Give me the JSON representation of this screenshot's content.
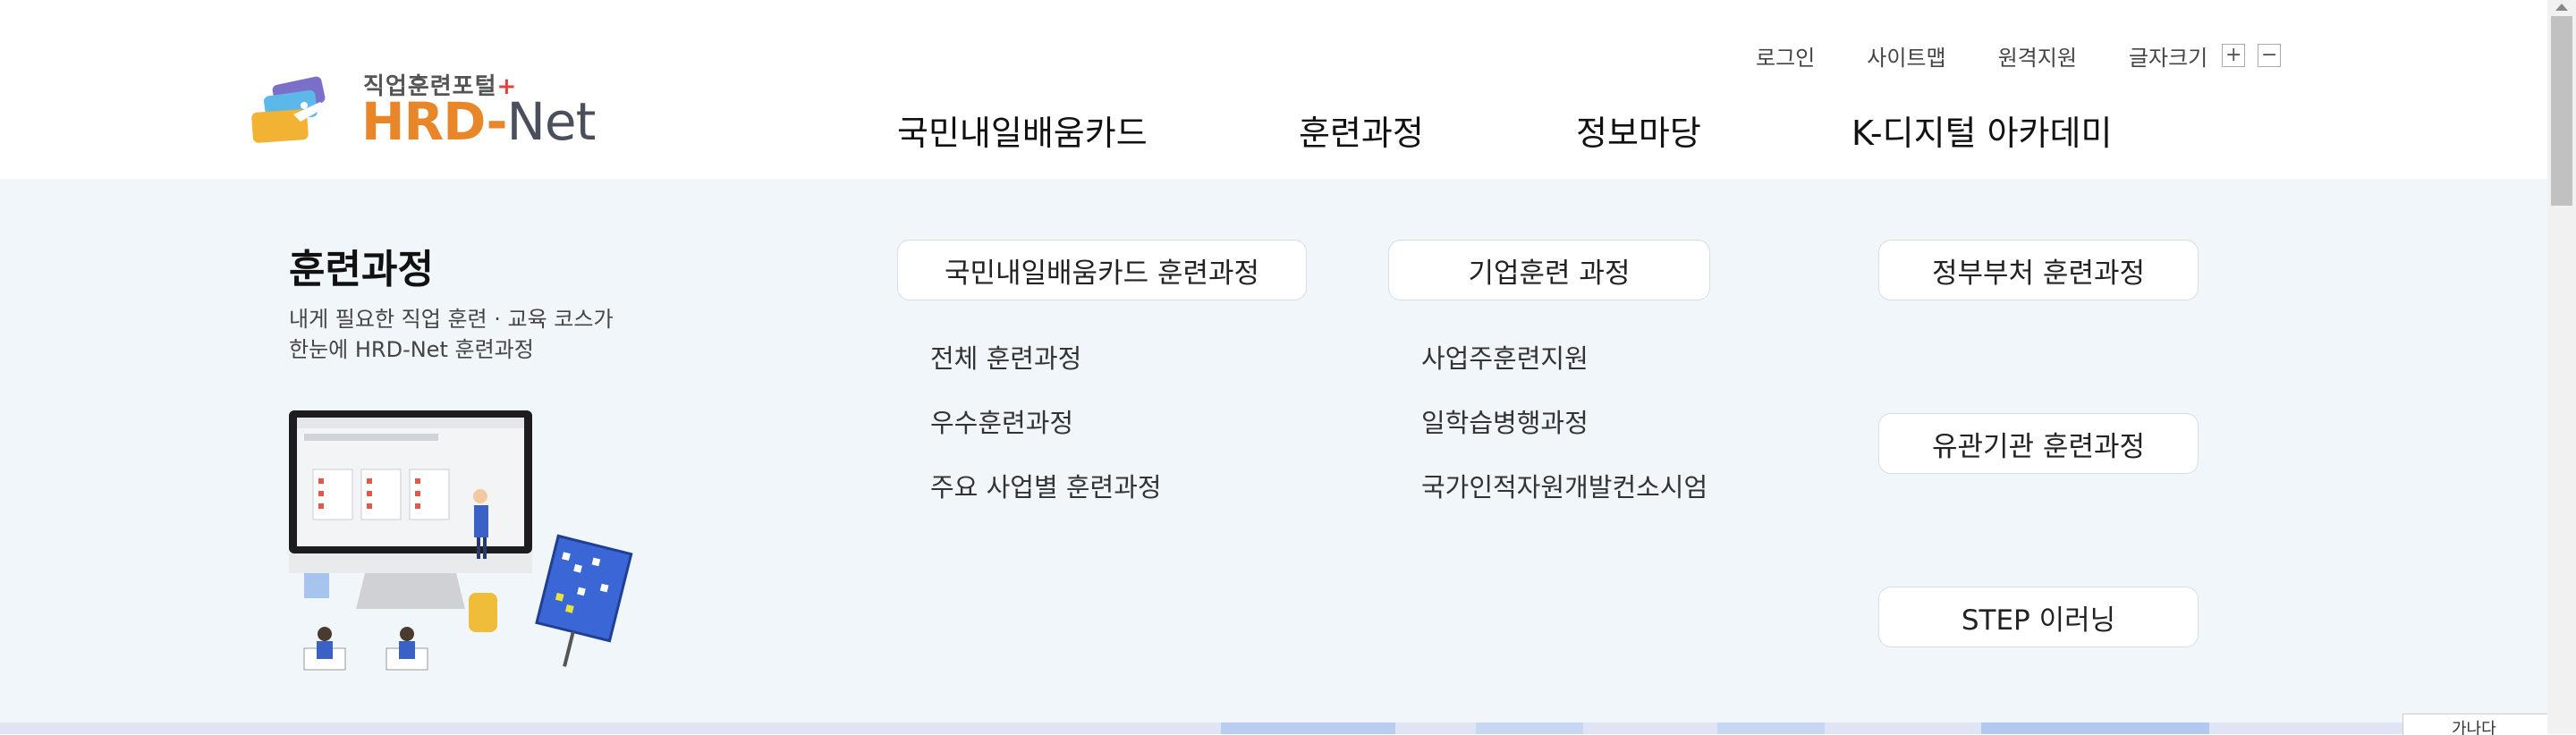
{
  "logo": {
    "small_text": "직업훈련포털",
    "plus": "+",
    "big_text": "HRD",
    "dash": "-",
    "net_text": "Net"
  },
  "util_menu": {
    "login": "로그인",
    "sitemap": "사이트맵",
    "remote_support": "원격지원",
    "font_size": "글자크기",
    "font_plus": "+",
    "font_minus": "−"
  },
  "gnb": {
    "items": [
      {
        "label": "국민내일배움카드"
      },
      {
        "label": "훈련과정"
      },
      {
        "label": "정보마당"
      },
      {
        "label": "K-디지털 아카데미"
      }
    ]
  },
  "mega": {
    "title": "훈련과정",
    "desc_line1": "내게 필요한 직업 훈련 · 교육 코스가",
    "desc_line2": "한눈에 HRD-Net 훈련과정",
    "col1": {
      "heading": "국민내일배움카드 훈련과정",
      "links": [
        "전체 훈련과정",
        "우수훈련과정",
        "주요 사업별 훈련과정"
      ]
    },
    "col2": {
      "heading": "기업훈련 과정",
      "links": [
        "사업주훈련지원",
        "일학습병행과정",
        "국가인적자원개발컨소시엄"
      ]
    },
    "col3": {
      "headings": [
        "정부부처 훈련과정",
        "유관기관 훈련과정",
        "STEP 이러닝"
      ]
    }
  },
  "side_widget": {
    "text": "가나다"
  },
  "colors": {
    "mega_bg": "#f1f6fb",
    "logo_orange": "#e8872a",
    "logo_gray": "#4a4f5c",
    "strip": "#dfe5f5"
  }
}
